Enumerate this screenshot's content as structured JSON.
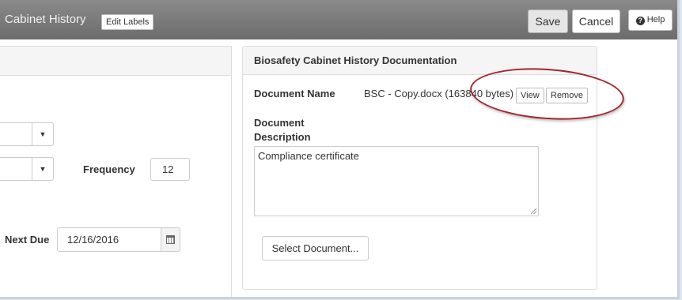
{
  "header": {
    "title": "Cabinet History",
    "edit_labels": "Edit Labels",
    "save": "Save",
    "cancel": "Cancel",
    "help": "Help"
  },
  "left_panel": {
    "frequency_label": "Frequency",
    "frequency_value": "12",
    "next_due_label": "Next Due",
    "next_due_value": "12/16/2016"
  },
  "documentation": {
    "title": "Biosafety Cabinet History Documentation",
    "document_name_label": "Document Name",
    "document_name_value": "BSC - Copy.docx (163840 bytes)",
    "view": "View",
    "remove": "Remove",
    "document_description_label_1": "Document",
    "document_description_label_2": "Description",
    "description_value": "Compliance certificate",
    "select_document": "Select Document..."
  },
  "icons": {
    "caret": "▼",
    "help": "?"
  },
  "colors": {
    "header_bg": "#7a7a7a",
    "annotation": "#a4262c"
  }
}
